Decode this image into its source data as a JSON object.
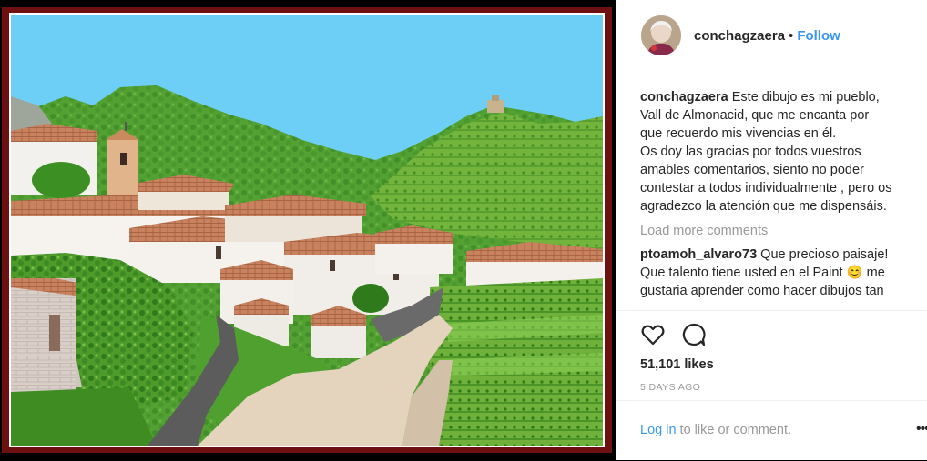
{
  "post": {
    "username": "conchagzaera",
    "separator": "•",
    "follow_label": "Follow",
    "caption_user": "conchagzaera",
    "caption_lines": [
      " Este dibujo es mi pueblo,",
      "Vall de Almonacid, que me encanta por",
      "que recuerdo mis vivencias en él.",
      "Os doy las gracias por todos vuestros",
      "amables comentarios, siento no poder",
      "contestar a todos individualmente , pero os",
      "agradezco la atención que me dispensáis."
    ],
    "load_more": "Load more comments",
    "comments": [
      {
        "user": "ptoamoh_alvaro73",
        "text_1": " Que precioso paisaje!",
        "text_2": "Que talento tiene usted en el Paint ",
        "emoji": "😊",
        "text_3": " me",
        "text_4": "gustaria aprender como hacer dibujos tan"
      }
    ],
    "likes": "51,101 likes",
    "timestamp": "5 DAYS AGO",
    "login_link": "Log in",
    "login_rest": " to like or comment.",
    "more_label": "•••"
  },
  "icons": {
    "like": "heart-icon",
    "comment": "speech-bubble-icon",
    "more": "more-options-icon"
  },
  "colors": {
    "frame": "#6e0f12",
    "sky": "#6dcff5",
    "link": "#3897f0",
    "text": "#262626",
    "muted": "#999999"
  }
}
